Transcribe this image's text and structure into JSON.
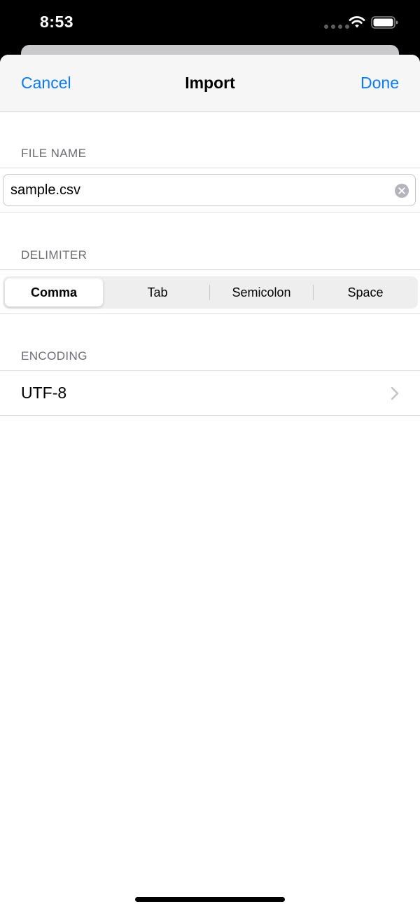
{
  "status_bar": {
    "time": "8:53"
  },
  "nav": {
    "cancel_label": "Cancel",
    "title": "Import",
    "done_label": "Done"
  },
  "sections": {
    "file_name": {
      "header": "FILE NAME",
      "value": "sample.csv"
    },
    "delimiter": {
      "header": "DELIMITER",
      "options": [
        "Comma",
        "Tab",
        "Semicolon",
        "Space"
      ],
      "selected": "Comma"
    },
    "encoding": {
      "header": "ENCODING",
      "value": "UTF-8"
    }
  },
  "icons": {
    "wifi": "wifi-icon",
    "battery": "battery-icon",
    "clear": "clear-icon",
    "chevron": "chevron-right-icon"
  },
  "colors": {
    "accent": "#0a7aff",
    "section_header": "#6d6d72",
    "nav_background": "#f6f6f7"
  }
}
